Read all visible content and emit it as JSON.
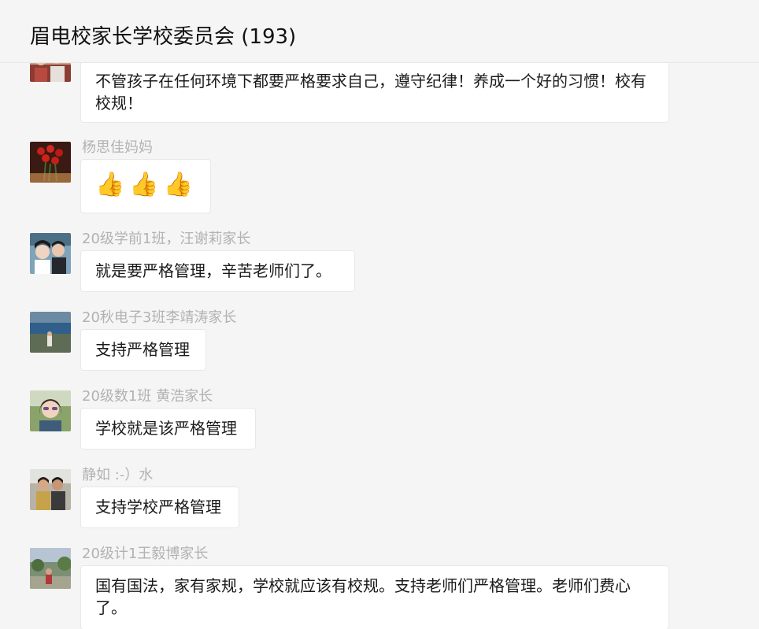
{
  "header": {
    "title": "眉电校家长学校委员会 (193)"
  },
  "messages": [
    {
      "sender": "",
      "text": "不管孩子在任何环境下都要严格要求自己，遵守纪律！养成一个好的习惯！校有校规！"
    },
    {
      "sender": "杨思佳妈妈",
      "text": "",
      "emoji": [
        "👍",
        "👍",
        "👍"
      ]
    },
    {
      "sender": "20级学前1班，汪谢莉家长",
      "text": "就是要严格管理，辛苦老师们了。"
    },
    {
      "sender": "20秋电子3班李靖涛家长",
      "text": "支持严格管理"
    },
    {
      "sender": "20级数1班 黄浩家长",
      "text": "学校就是该严格管理"
    },
    {
      "sender": "静如 :-）水",
      "text": "支持学校严格管理"
    },
    {
      "sender": "20级计1王毅博家长",
      "text": "国有国法，家有家规，学校就应该有校规。支持老师们严格管理。老师们费心了。"
    }
  ],
  "colors": {
    "sender": "#b2b2b2",
    "bubble": "#ffffff",
    "background": "#f5f5f5"
  },
  "icons": [
    "avatar-group-photo",
    "avatar-roses",
    "avatar-two-girls",
    "avatar-stadium",
    "avatar-woman-sunglasses",
    "avatar-couple",
    "avatar-garden"
  ]
}
